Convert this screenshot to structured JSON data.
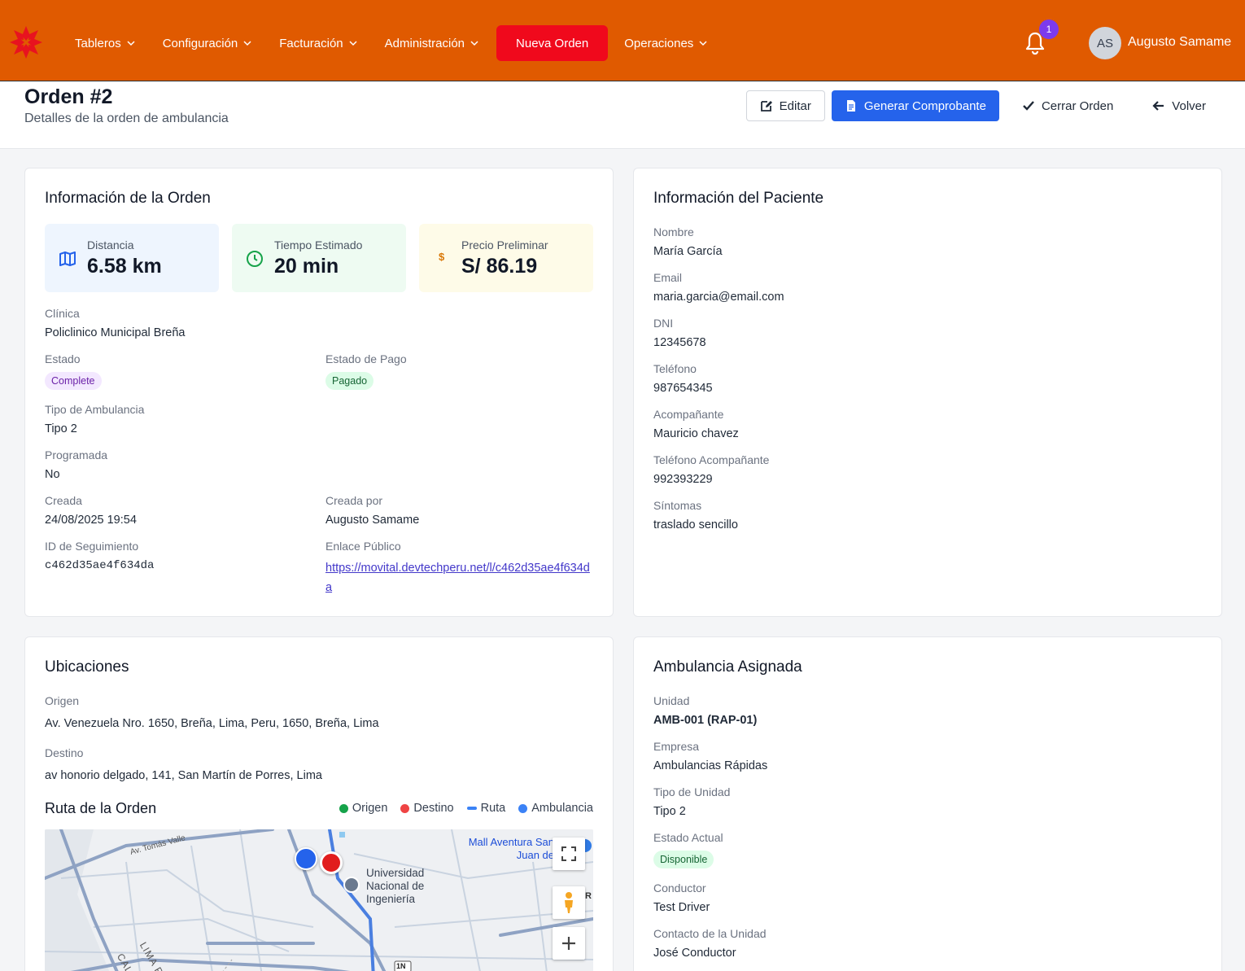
{
  "nav": {
    "items": [
      {
        "label": "Tableros"
      },
      {
        "label": "Configuración"
      },
      {
        "label": "Facturación"
      },
      {
        "label": "Administración"
      }
    ],
    "cta": "Nueva Orden",
    "operations": "Operaciones",
    "notif_count": "1",
    "user_initials": "AS",
    "user_name": "Augusto Samame"
  },
  "header": {
    "title": "Orden #2",
    "subtitle": "Detalles de la orden de ambulancia",
    "edit": "Editar",
    "generate": "Generar Comprobante",
    "close": "Cerrar Orden",
    "back": "Volver"
  },
  "order": {
    "title": "Información de la Orden",
    "distance_label": "Distancia",
    "distance": "6.58 km",
    "time_label": "Tiempo Estimado",
    "time": "20 min",
    "price_label": "Precio Preliminar",
    "price": "S/ 86.19",
    "price_icon": "$",
    "clinic_label": "Clínica",
    "clinic": "Policlinico Municipal Breña",
    "status_label": "Estado",
    "status": "Complete",
    "payment_label": "Estado de Pago",
    "payment": "Pagado",
    "type_label": "Tipo de Ambulancia",
    "type": "Tipo 2",
    "scheduled_label": "Programada",
    "scheduled": "No",
    "created_label": "Creada",
    "created": "24/08/2025 19:54",
    "created_by_label": "Creada por",
    "created_by": "Augusto Samame",
    "tracking_label": "ID de Seguimiento",
    "tracking": "c462d35ae4f634da",
    "public_label": "Enlace Público",
    "public_link": "https://movital.devtechperu.net/l/c462d35ae4f634da"
  },
  "patient": {
    "title": "Información del Paciente",
    "name_label": "Nombre",
    "name": "María García",
    "email_label": "Email",
    "email": "maria.garcia@email.com",
    "dni_label": "DNI",
    "dni": "12345678",
    "phone_label": "Teléfono",
    "phone": "987654345",
    "companion_label": "Acompañante",
    "companion": "Mauricio chavez",
    "companion_phone_label": "Teléfono Acompañante",
    "companion_phone": "992393229",
    "symptoms_label": "Síntomas",
    "symptoms": "traslado sencillo"
  },
  "locations": {
    "title": "Ubicaciones",
    "origin_label": "Origen",
    "origin": "Av. Venezuela Nro. 1650, Breña, Lima, Peru, 1650, Breña, Lima",
    "destination_label": "Destino",
    "destination": "av honorio delgado, 141, San Martín de Porres, Lima",
    "route_title": "Ruta de la Orden",
    "legend": [
      {
        "label": "Origen",
        "color": "#16a34a"
      },
      {
        "label": "Destino",
        "color": "#ef4444"
      },
      {
        "label": "Ruta",
        "color": "#3b82f6"
      },
      {
        "label": "Ambulancia",
        "color": "#3b82f6"
      }
    ],
    "map": {
      "poi_mall": "Mall Aventura San Juan de Lurigancho",
      "poi_uni_1": "Universidad",
      "poi_uni_2": "Nacional de",
      "poi_uni_3": "Ingeniería",
      "road_1": "Av. Tomás Valle",
      "area_1": "LIMA PROV.",
      "area_2": "CALLAO",
      "highway": "1N",
      "cut_label": "R"
    }
  },
  "ambulance": {
    "title": "Ambulancia Asignada",
    "unit_label": "Unidad",
    "unit": "AMB-001 (RAP-01)",
    "company_label": "Empresa",
    "company": "Ambulancias Rápidas",
    "unit_type_label": "Tipo de Unidad",
    "unit_type": "Tipo 2",
    "current_status_label": "Estado Actual",
    "current_status": "Disponible",
    "driver_label": "Conductor",
    "driver": "Test Driver",
    "contact_label": "Contacto de la Unidad",
    "contact": "José Conductor"
  }
}
